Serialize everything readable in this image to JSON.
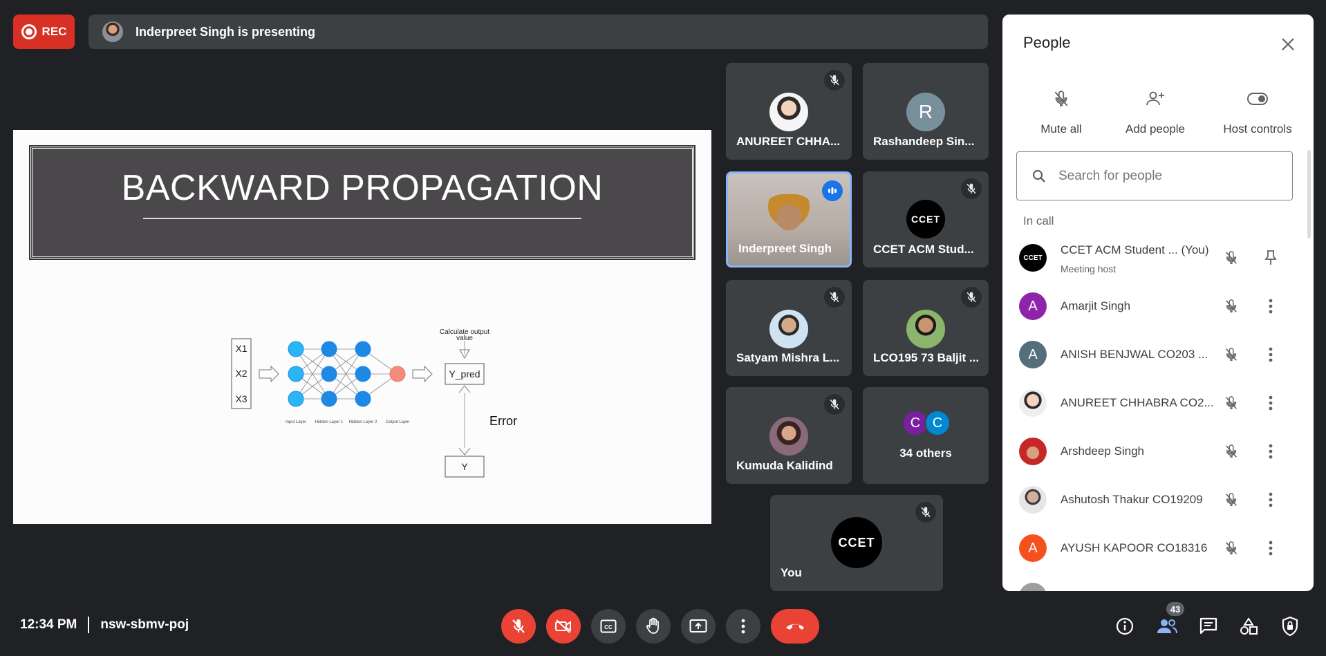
{
  "recording": {
    "label": "REC"
  },
  "presenting_bar": {
    "text": "Inderpreet Singh is presenting"
  },
  "slide": {
    "title": "BACKWARD PROPAGATION",
    "inputs": [
      "X1",
      "X2",
      "X3"
    ],
    "layer_labels": [
      "Input Layer",
      "Hidden Layer 1",
      "Hidden Layer 2",
      "Output Layer"
    ],
    "output_box": "Y_pred",
    "calculate_label_1": "Calculate output",
    "calculate_label_2": "value",
    "error_label": "Error",
    "target_box": "Y"
  },
  "tiles": [
    {
      "name": "ANUREET CHHA...",
      "muted": true
    },
    {
      "name": "Rashandeep Sin...",
      "avatar_letter": "R",
      "avatar_color": "#78909c"
    },
    {
      "name": "Inderpreet Singh",
      "speaking": true
    },
    {
      "name": "CCET ACM Stud...",
      "muted": true
    },
    {
      "name": "Satyam Mishra L...",
      "muted": true
    },
    {
      "name": "LCO195 73 Baljit ...",
      "muted": true
    },
    {
      "name": "Kumuda Kalidind",
      "muted": true
    },
    {
      "name": "34 others",
      "avatar_letters": [
        "C",
        "C"
      ],
      "avatar_colors": [
        "#7b1fa2",
        "#0288d1"
      ]
    },
    {
      "name": "You",
      "muted": true
    }
  ],
  "people_panel": {
    "title": "People",
    "actions": [
      "Mute all",
      "Add people",
      "Host controls"
    ],
    "search_placeholder": "Search for people",
    "section_label": "In call",
    "people": [
      {
        "name": "CCET ACM Student ... (You)",
        "subtitle": "Meeting host",
        "avatar_type": "ccet-logo"
      },
      {
        "name": "Amarjit Singh",
        "avatar_letter": "A",
        "avatar_color": "#8e24aa"
      },
      {
        "name": "ANISH BENJWAL CO203 ...",
        "avatar_letter": "A",
        "avatar_color": "#546e7a"
      },
      {
        "name": "ANUREET CHHABRA CO2...",
        "avatar_type": "photo"
      },
      {
        "name": "Arshdeep Singh",
        "avatar_type": "photo"
      },
      {
        "name": "Ashutosh Thakur CO19209",
        "avatar_type": "photo"
      },
      {
        "name": "AYUSH KAPOOR CO18316",
        "avatar_letter": "A",
        "avatar_color": "#f4511e"
      }
    ]
  },
  "bottom_bar": {
    "time": "12:34 PM",
    "meeting_code": "nsw-sbmv-poj",
    "people_count": "43"
  },
  "colors": {
    "red": "#ea4335",
    "dark_bg": "#202124",
    "tile_bg": "#3c4043",
    "speaking_border": "#8ab4f8"
  }
}
